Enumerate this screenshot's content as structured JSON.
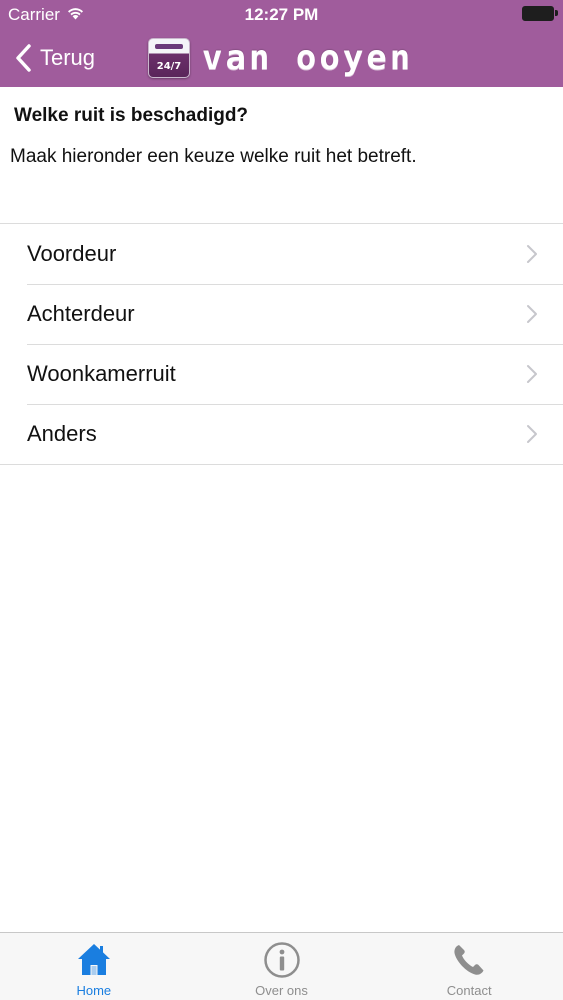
{
  "status_bar": {
    "carrier": "Carrier",
    "time": "12:27 PM"
  },
  "nav": {
    "back_label": "Terug",
    "logo_text": "van ooyen",
    "logo_badge": "24/7"
  },
  "content": {
    "title": "Welke ruit is beschadigd?",
    "description": "Maak hieronder een keuze welke ruit het betreft."
  },
  "options": [
    {
      "label": "Voordeur"
    },
    {
      "label": "Achterdeur"
    },
    {
      "label": "Woonkamerruit"
    },
    {
      "label": "Anders"
    }
  ],
  "tabs": [
    {
      "label": "Home",
      "icon": "home-icon",
      "active": true
    },
    {
      "label": "Over ons",
      "icon": "info-icon",
      "active": false
    },
    {
      "label": "Contact",
      "icon": "phone-icon",
      "active": false
    }
  ],
  "colors": {
    "header": "#a05c9c",
    "tab_active": "#1a7ee0",
    "tab_inactive": "#8e8e8e"
  }
}
